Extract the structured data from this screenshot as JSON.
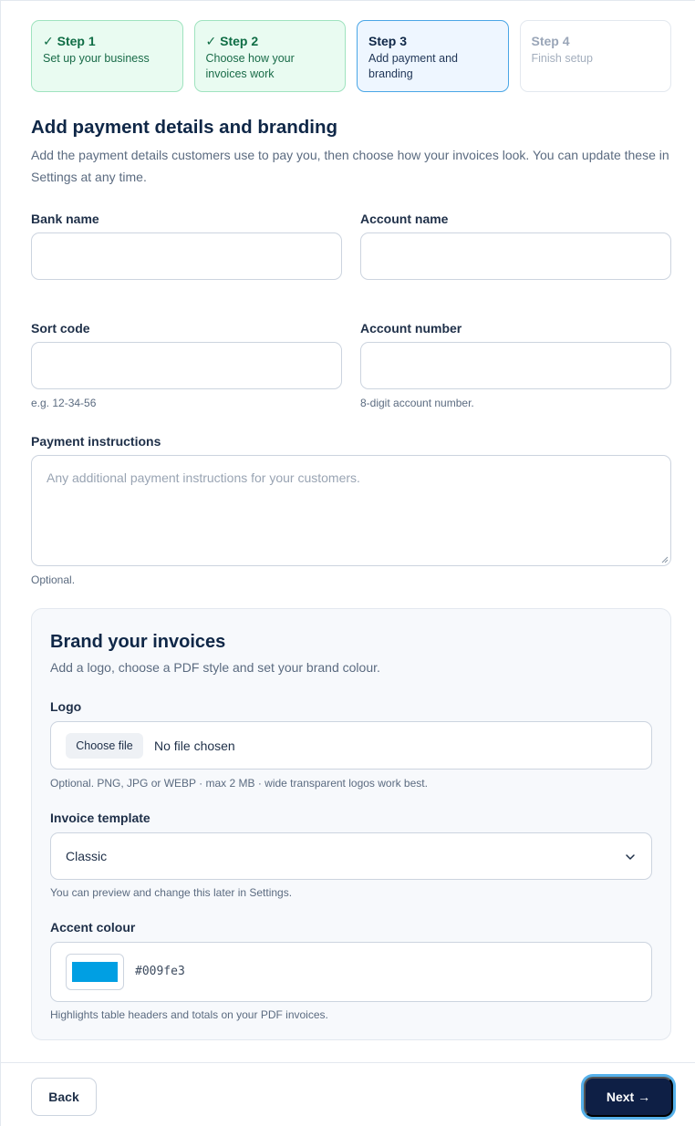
{
  "steps": [
    {
      "title": "✓ Step 1",
      "desc": "Set up your business",
      "state": "done"
    },
    {
      "title": "✓ Step 2",
      "desc": "Choose how your invoices work",
      "state": "done"
    },
    {
      "title": "Step 3",
      "desc": "Add payment and branding",
      "state": "active"
    },
    {
      "title": "Step 4",
      "desc": "Finish setup",
      "state": "todo"
    }
  ],
  "heading": "Add payment details and branding",
  "intro": "Add the payment details customers use to pay you, then choose how your invoices look. You can update these in Settings at any time.",
  "fields": {
    "bank_name": {
      "label": "Bank name",
      "value": ""
    },
    "account_name": {
      "label": "Account name",
      "value": ""
    },
    "sort_code": {
      "label": "Sort code",
      "value": "",
      "hint": "e.g. 12-34-56"
    },
    "account_number": {
      "label": "Account number",
      "value": "",
      "hint": "8-digit account number."
    },
    "payment_instructions": {
      "label": "Payment instructions",
      "placeholder": "Any additional payment instructions for your customers.",
      "hint": "Optional."
    }
  },
  "branding": {
    "title": "Brand your invoices",
    "subtitle": "Add a logo, choose a PDF style and set your brand colour.",
    "logo": {
      "label": "Logo",
      "button": "Choose file",
      "status": "No file chosen",
      "hint": "Optional. PNG, JPG or WEBP · max 2 MB · wide transparent logos work best."
    },
    "template": {
      "label": "Invoice template",
      "value": "Classic",
      "hint": "You can preview and change this later in Settings."
    },
    "accent": {
      "label": "Accent colour",
      "value": "#009fe3",
      "hint": "Highlights table headers and totals on your PDF invoices."
    }
  },
  "footer": {
    "back": "Back",
    "next": "Next →"
  },
  "colors": {
    "accent": "#009fe3",
    "primary_button": "#0e1f45"
  },
  "icons": {
    "select": "chevron-down-icon",
    "textarea": "resize-handle-icon"
  }
}
